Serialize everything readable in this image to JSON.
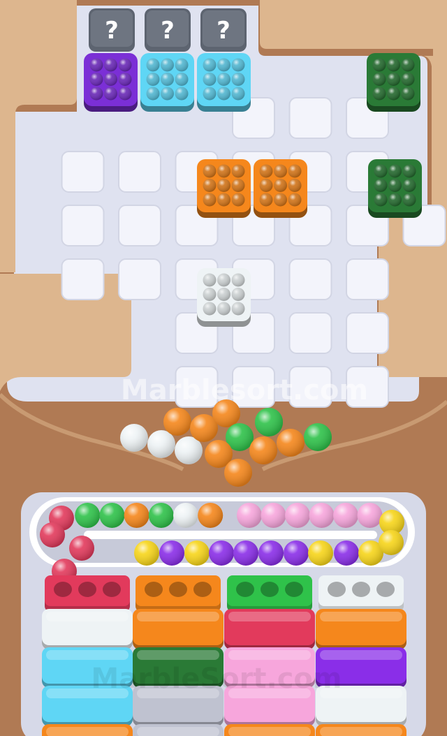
{
  "watermark": "Marblesort.com",
  "watermark_bottom": "MarbleSort.com",
  "colors": {
    "purple": "#7b2fd6",
    "cyan": "#5fd6f5",
    "darkgreen": "#2a7a36",
    "orange": "#f5871c",
    "white": "#eef3f5",
    "green": "#2fc24a",
    "pink": "#f7a6dc",
    "red": "#e23a5c",
    "yellow": "#f7d51a",
    "violet": "#8a2ee8",
    "board_bg": "#dde0ee",
    "tile": "#eef0f8",
    "sand": "#ddb68e",
    "wood": "#b07a54"
  },
  "grid": {
    "cols": 7,
    "rows": 6
  },
  "mystery_label": "?",
  "mystery_boxes": [
    {
      "col": 1,
      "row": 0
    },
    {
      "col": 2,
      "row": 0
    },
    {
      "col": 3,
      "row": 0
    }
  ],
  "marble_boxes": [
    {
      "name": "purple-box",
      "color": "purple",
      "col": 1,
      "row": 1
    },
    {
      "name": "cyan-box-1",
      "color": "cyan",
      "col": 2,
      "row": 1
    },
    {
      "name": "cyan-box-2",
      "color": "cyan",
      "col": 3,
      "row": 1
    },
    {
      "name": "darkgreen-box-1",
      "color": "darkgreen",
      "col": 7,
      "row": 1
    },
    {
      "name": "orange-box-1",
      "color": "orange",
      "col": 4,
      "row": 3
    },
    {
      "name": "orange-box-2",
      "color": "orange",
      "col": 5,
      "row": 3
    },
    {
      "name": "darkgreen-box-2",
      "color": "darkgreen",
      "col": 7,
      "row": 3
    },
    {
      "name": "white-box",
      "color": "white",
      "col": 4,
      "row": 5
    }
  ],
  "funnel_marbles": [
    "white",
    "white",
    "white",
    "orange",
    "orange",
    "orange",
    "green",
    "green",
    "orange",
    "orange",
    "green",
    "orange",
    "orange",
    "green"
  ],
  "conveyor_top": [
    "red",
    "green",
    "green",
    "orange",
    "green",
    "white",
    "orange",
    "empty",
    "pink",
    "pink",
    "pink",
    "pink",
    "pink",
    "pink",
    "yellow"
  ],
  "conveyor_bottom": [
    "red",
    "red",
    "empty",
    "empty",
    "yellow",
    "violet",
    "yellow",
    "violet",
    "violet",
    "violet",
    "violet",
    "yellow",
    "violet",
    "yellow",
    "yellow"
  ],
  "sort_columns": [
    {
      "cup": "red",
      "slots": [
        "white",
        "cyan",
        "cyan",
        "orange"
      ]
    },
    {
      "cup": "orange",
      "slots": [
        "orange",
        "darkgreen",
        "grey",
        "grey"
      ]
    },
    {
      "cup": "green",
      "slots": [
        "red",
        "pink",
        "pink",
        "orange"
      ]
    },
    {
      "cup": "white",
      "slots": [
        "orange",
        "violet",
        "white",
        "orange"
      ]
    }
  ]
}
